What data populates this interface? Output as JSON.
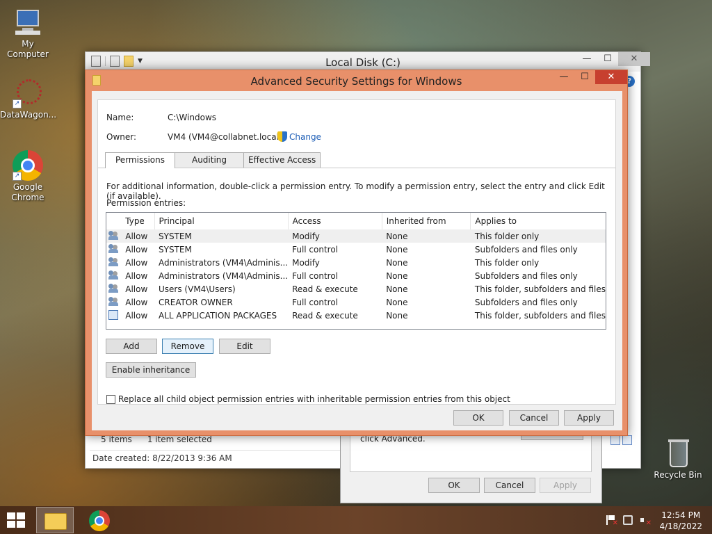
{
  "desktop": {
    "icons": [
      {
        "label": "My Computer"
      },
      {
        "label": "DataWagon..."
      },
      {
        "label": "Google Chrome"
      },
      {
        "label": "Recycle Bin"
      }
    ]
  },
  "explorer": {
    "title": "Local Disk (C:)",
    "status_items": "5 items",
    "status_selected": "1 item selected",
    "date_created": "Date created: 8/22/2013 9:36 AM"
  },
  "properties": {
    "text": "click Advanced.",
    "ok": "OK",
    "cancel": "Cancel",
    "apply": "Apply"
  },
  "dialog": {
    "title": "Advanced Security Settings for Windows",
    "name_label": "Name:",
    "name_value": "C:\\Windows",
    "owner_label": "Owner:",
    "owner_value": "VM4 (VM4@collabnet.local)",
    "change_link": "Change",
    "tabs": [
      {
        "label": "Permissions",
        "active": true
      },
      {
        "label": "Auditing",
        "active": false
      },
      {
        "label": "Effective Access",
        "active": false
      }
    ],
    "info_text": "For additional information, double-click a permission entry. To modify a permission entry, select the entry and click Edit (if available).",
    "entries_label": "Permission entries:",
    "columns": [
      "Type",
      "Principal",
      "Access",
      "Inherited from",
      "Applies to"
    ],
    "rows": [
      {
        "icon": "user-group-icon",
        "type": "Allow",
        "principal": "SYSTEM",
        "access": "Modify",
        "inherited": "None",
        "applies": "This folder only"
      },
      {
        "icon": "user-group-icon",
        "type": "Allow",
        "principal": "SYSTEM",
        "access": "Full control",
        "inherited": "None",
        "applies": "Subfolders and files only"
      },
      {
        "icon": "user-group-icon",
        "type": "Allow",
        "principal": "Administrators (VM4\\Adminis...",
        "access": "Modify",
        "inherited": "None",
        "applies": "This folder only"
      },
      {
        "icon": "user-group-icon",
        "type": "Allow",
        "principal": "Administrators (VM4\\Adminis...",
        "access": "Full control",
        "inherited": "None",
        "applies": "Subfolders and files only"
      },
      {
        "icon": "user-group-icon",
        "type": "Allow",
        "principal": "Users (VM4\\Users)",
        "access": "Read & execute",
        "inherited": "None",
        "applies": "This folder, subfolders and files"
      },
      {
        "icon": "user-group-icon",
        "type": "Allow",
        "principal": "CREATOR OWNER",
        "access": "Full control",
        "inherited": "None",
        "applies": "Subfolders and files only"
      },
      {
        "icon": "package-icon",
        "type": "Allow",
        "principal": "ALL APPLICATION PACKAGES",
        "access": "Read & execute",
        "inherited": "None",
        "applies": "This folder, subfolders and files"
      }
    ],
    "add": "Add",
    "remove": "Remove",
    "edit": "Edit",
    "enable_inheritance": "Enable inheritance",
    "replace_checkbox": "Replace all child object permission entries with inheritable permission entries from this object",
    "ok": "OK",
    "cancel": "Cancel",
    "apply": "Apply"
  },
  "taskbar": {
    "time": "12:54 PM",
    "date": "4/18/2022"
  },
  "colors": {
    "dialog_frame": "#e8906a",
    "close_button": "#c7402f",
    "link": "#1a5bb5"
  }
}
